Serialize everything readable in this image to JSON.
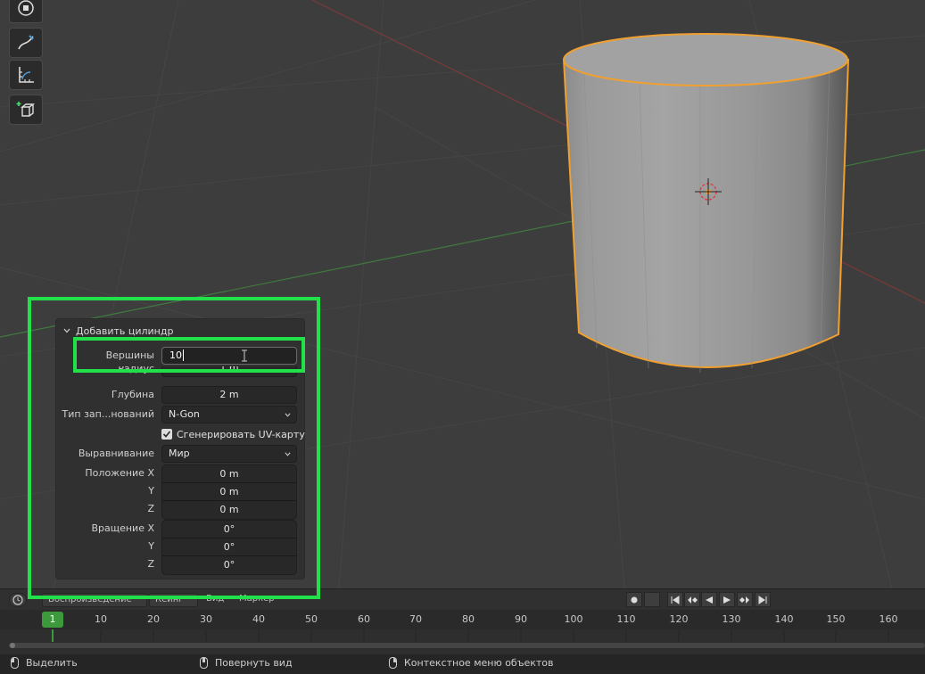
{
  "operator_panel": {
    "title": "Добавить цилиндр",
    "vertices": {
      "label": "Вершины",
      "value": "10"
    },
    "radius": {
      "label": "Радиус",
      "value": "1 m"
    },
    "depth": {
      "label": "Глубина",
      "value": "2 m"
    },
    "cap_fill": {
      "label": "Тип зап...нований",
      "value": "N-Gon"
    },
    "generate_uv": {
      "label": "Сгенерировать UV-карту",
      "checked": true
    },
    "align": {
      "label": "Выравнивание",
      "value": "Мир"
    },
    "location": {
      "label": "Положение X",
      "y_label": "Y",
      "z_label": "Z",
      "x": "0 m",
      "y": "0 m",
      "z": "0 m"
    },
    "rotation": {
      "label": "Вращение X",
      "y_label": "Y",
      "z_label": "Z",
      "x": "0°",
      "y": "0°",
      "z": "0°"
    }
  },
  "timeline": {
    "menus": [
      "Воспроизведение",
      "Кеинг",
      "Вид",
      "Маркер"
    ],
    "current_frame": "1",
    "ruler": [
      "10",
      "20",
      "30",
      "40",
      "50",
      "60",
      "70",
      "80",
      "90",
      "100",
      "110",
      "120",
      "130",
      "140",
      "150",
      "160"
    ]
  },
  "status_bar": {
    "select": "Выделить",
    "rotate_view": "Повернуть вид",
    "context_menu": "Контекстное меню объектов"
  },
  "colors": {
    "highlight": "#21e04a",
    "selection_outline": "#f0a030",
    "current_frame": "#3c9a3c"
  },
  "icons": {
    "tools": [
      "transform-icon",
      "annotate-icon",
      "measure-icon",
      "add-cube-icon"
    ]
  }
}
